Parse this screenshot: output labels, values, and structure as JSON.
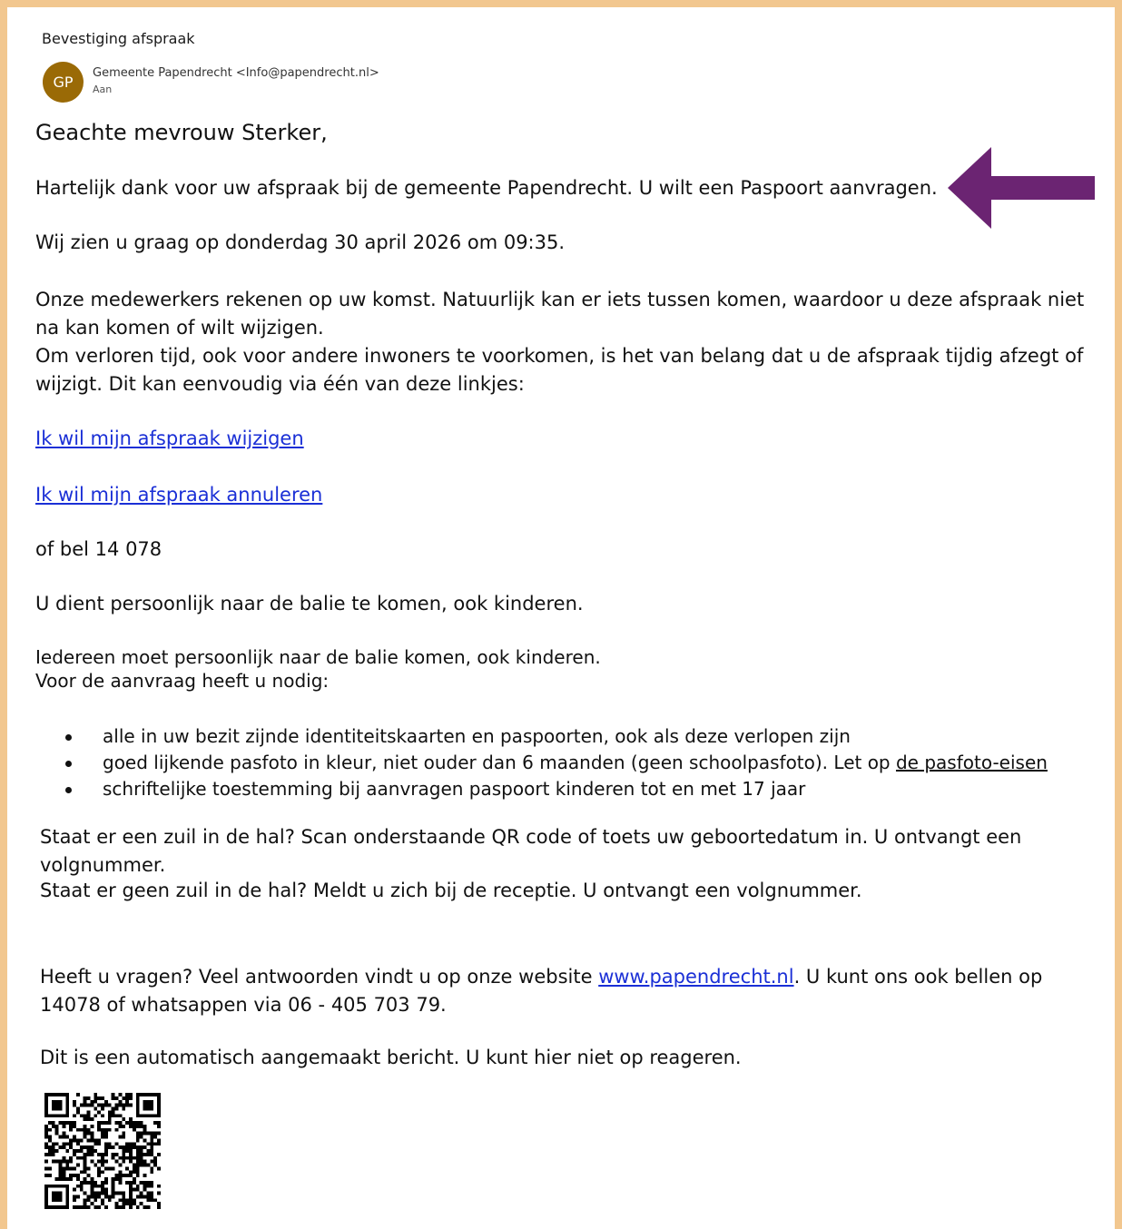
{
  "email": {
    "subject": "Bevestiging afspraak",
    "avatar_initials": "GP",
    "avatar_color": "#9a6a06",
    "sender": "Gemeente Papendrecht <Info@papendrecht.nl>",
    "to_label": "Aan"
  },
  "body": {
    "greeting": "Geachte mevrouw Sterker,",
    "thanks": "Hartelijk dank voor uw afspraak bij de gemeente Papendrecht. U wilt een Paspoort aanvragen.",
    "appointment": "Wij zien u graag op donderdag 30 april 2026 om 09:35.",
    "para1": "Onze medewerkers rekenen op uw komst. Natuurlijk kan er iets tussen komen, waardoor u deze afspraak niet na kan komen of wilt wijzigen.",
    "para2": "Om verloren tijd, ook voor andere inwoners te voorkomen, is het van belang dat u de afspraak tijdig afzegt of wijzigt. Dit kan eenvoudig via één van deze linkjes:",
    "link_change": "Ik wil mijn afspraak wijzigen",
    "link_cancel": "Ik wil mijn afspraak annuleren",
    "call": "of bel 14 078",
    "in_person": "U dient persoonlijk naar de balie te komen, ook kinderen.",
    "everyone": "Iedereen moet persoonlijk naar de balie komen, ook kinderen.",
    "needed": "Voor de aanvraag heeft u nodig:",
    "bullets": [
      "alle in uw bezit zijnde identiteitskaarten en paspoorten, ook als deze verlopen zijn",
      "goed lijkende pasfoto in kleur, niet ouder dan 6 maanden (geen schoolpasfoto). Let op ",
      "schriftelijke toestemming bij aanvragen paspoort kinderen tot en met 17 jaar"
    ],
    "photo_link": "de pasfoto-eisen",
    "kiosk": "Staat er een zuil in de hal? Scan onderstaande QR code of toets uw geboortedatum in. U ontvangt een volgnummer.",
    "no_kiosk": "Staat er geen zuil in de hal? Meldt u zich bij de receptie. U ontvangt een volgnummer.",
    "questions_pre": "Heeft u vragen? Veel antwoorden vindt u op onze website ",
    "website": "www.papendrecht.nl",
    "questions_post": ". U kunt ons ook bellen op 14078 of whatsappen via 06 - 405 703 79.",
    "auto": "Dit is een automatisch aangemaakt bericht. U kunt hier niet op reageren."
  },
  "colors": {
    "frame": "#f2c78f",
    "link": "#1a2fd6",
    "arrow": "#6b2472"
  }
}
